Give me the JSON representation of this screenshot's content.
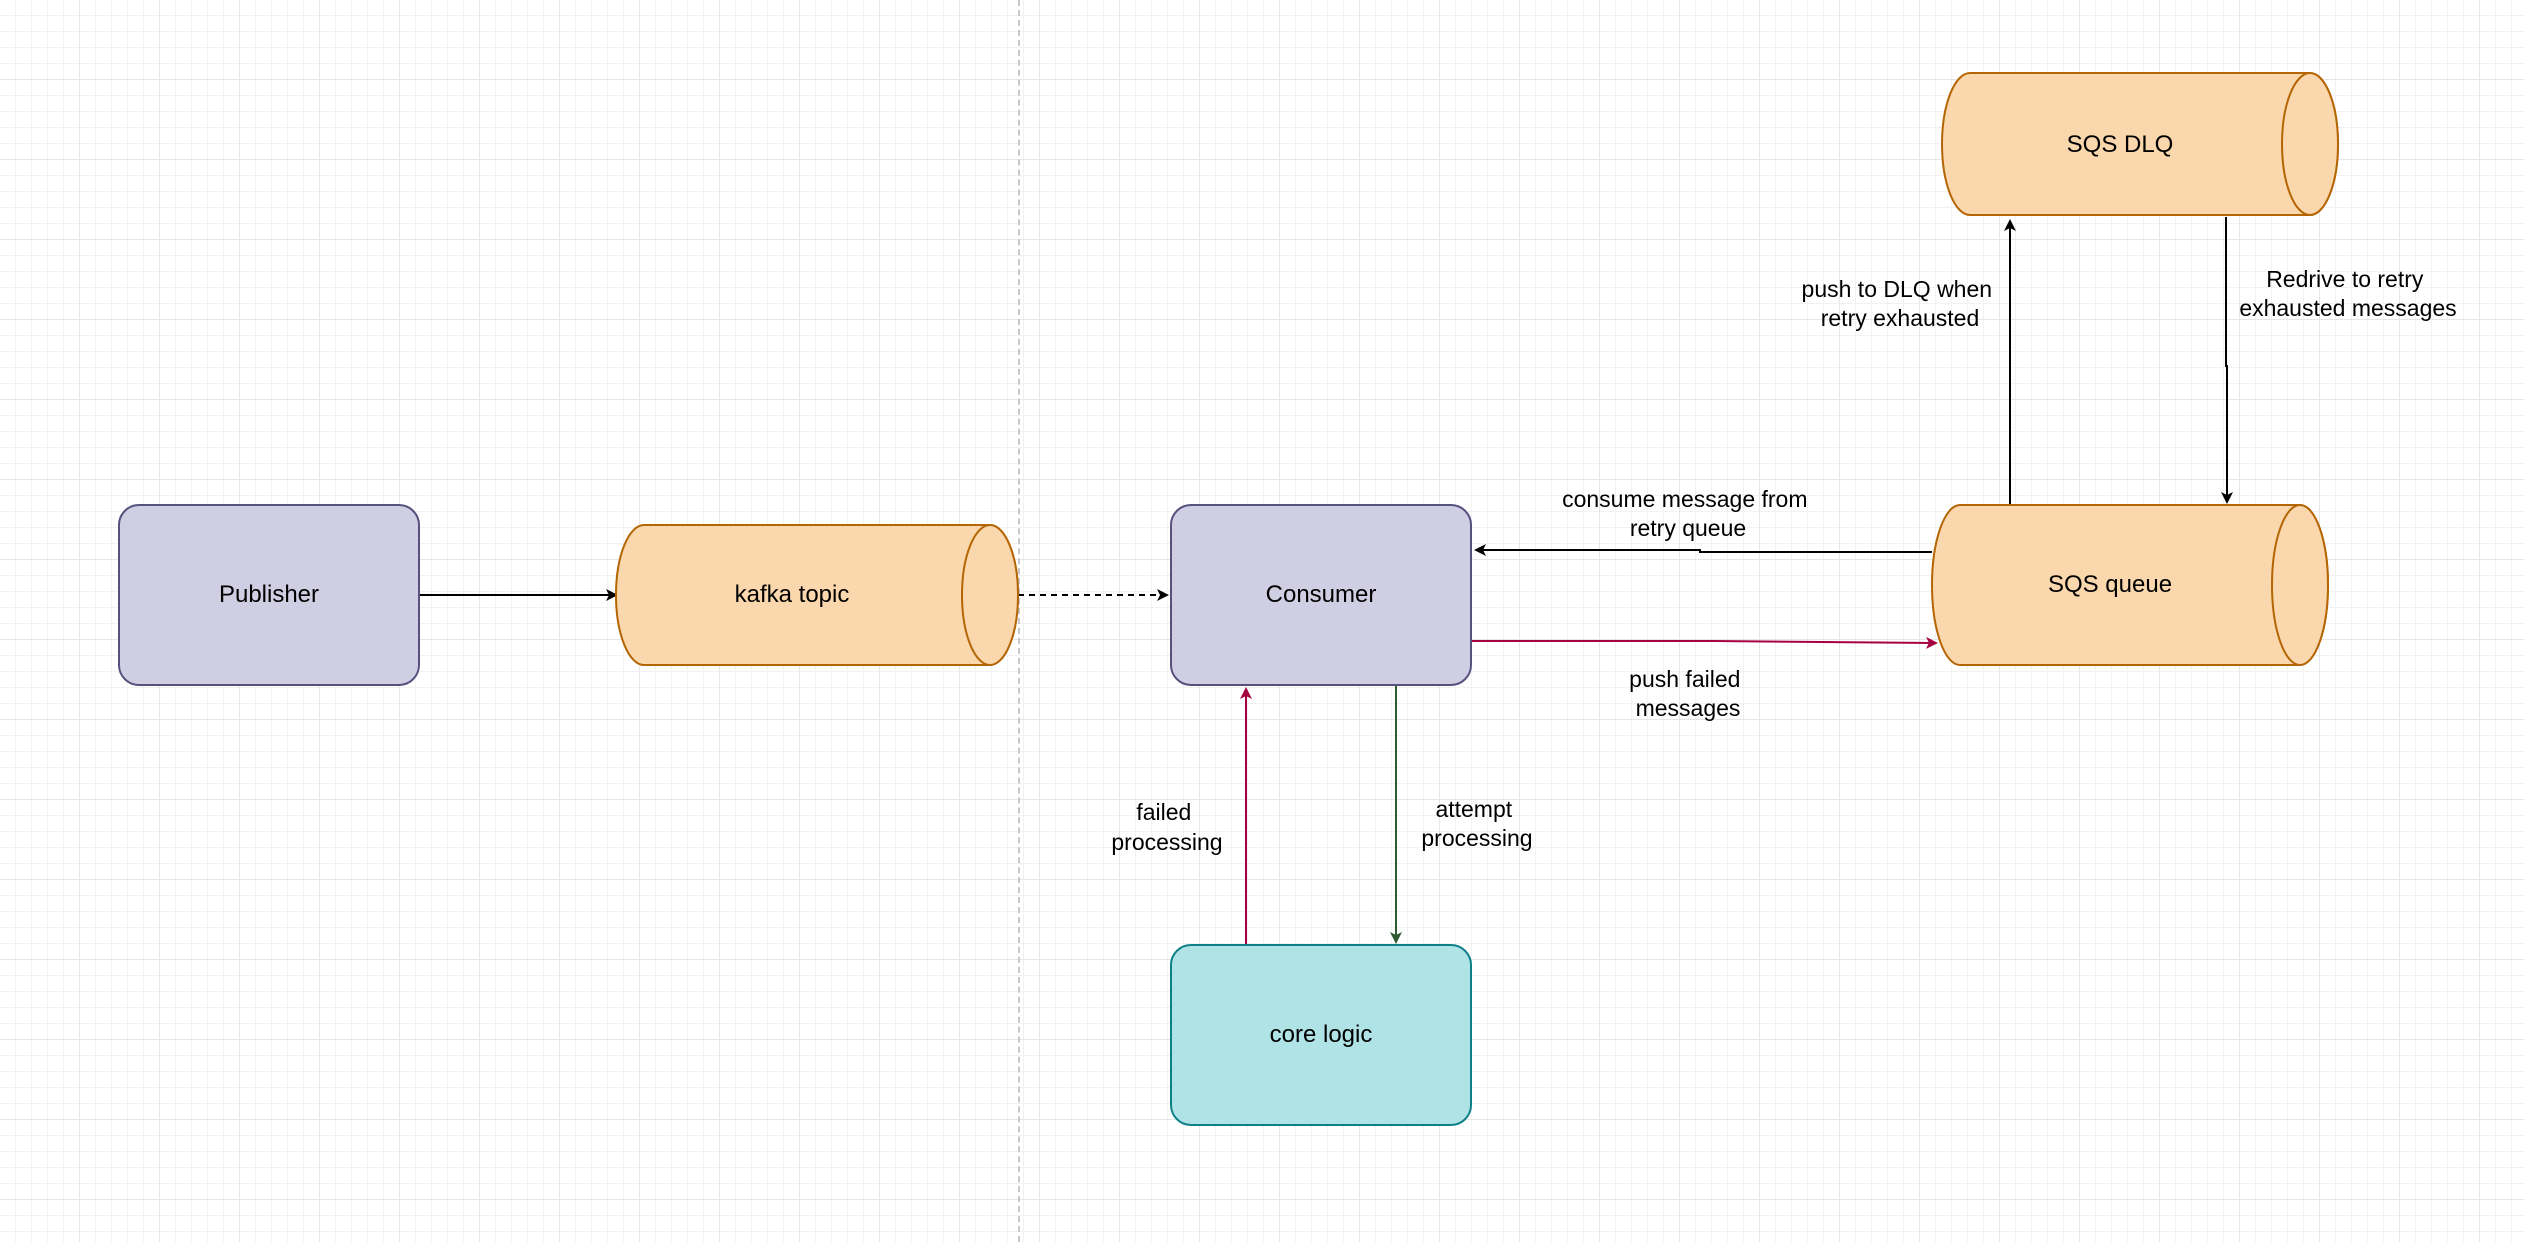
{
  "colors": {
    "process_fill": "#d0cee2",
    "process_stroke": "#56517e",
    "queue_fill": "#fad7ac",
    "queue_stroke": "#b46504",
    "logic_fill": "#b0e3e6",
    "logic_stroke": "#0e8088",
    "edge_default": "#000000",
    "edge_failure": "#a50040",
    "edge_attempt": "#2d5a2e"
  },
  "nodes": {
    "publisher": {
      "label": "Publisher"
    },
    "kafka_topic": {
      "label": "kafka topic"
    },
    "consumer": {
      "label": "Consumer"
    },
    "core_logic": {
      "label": "core logic"
    },
    "sqs_queue": {
      "label": "SQS queue"
    },
    "sqs_dlq": {
      "label": "SQS DLQ"
    }
  },
  "edges": {
    "publisher_to_kafka": {
      "label": ""
    },
    "kafka_to_consumer": {
      "label": ""
    },
    "consumer_to_core": {
      "lines": [
        "attempt",
        "processing"
      ]
    },
    "core_to_consumer": {
      "lines": [
        "failed",
        "processing"
      ]
    },
    "consumer_to_sqs": {
      "lines": [
        "push failed",
        "messages"
      ]
    },
    "sqs_to_consumer": {
      "lines": [
        "consume message from",
        "retry queue"
      ]
    },
    "sqs_to_dlq": {
      "lines": [
        "push to DLQ when",
        "retry exhausted"
      ]
    },
    "dlq_to_sqs": {
      "lines": [
        "Redrive to retry",
        "exhausted messages"
      ]
    }
  }
}
